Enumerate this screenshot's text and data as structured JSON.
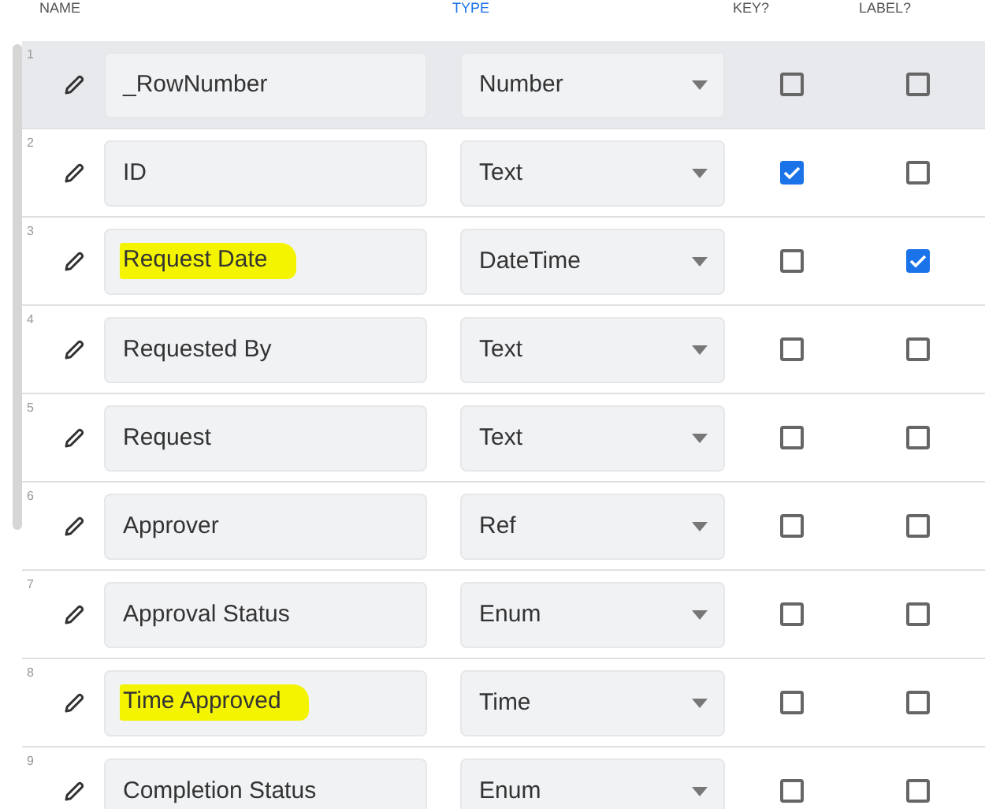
{
  "columns": [
    {
      "label": "NAME",
      "active": false
    },
    {
      "label": "TYPE",
      "active": true
    },
    {
      "label": "KEY?",
      "active": false
    },
    {
      "label": "LABEL?",
      "active": false
    }
  ],
  "rows": [
    {
      "number": "1",
      "name": "_RowNumber",
      "type": "Number",
      "key": false,
      "label": false,
      "selected": true,
      "highlighted": false
    },
    {
      "number": "2",
      "name": "ID",
      "type": "Text",
      "key": true,
      "label": false,
      "selected": false,
      "highlighted": false
    },
    {
      "number": "3",
      "name": "Request Date",
      "type": "DateTime",
      "key": false,
      "label": true,
      "selected": false,
      "highlighted": true
    },
    {
      "number": "4",
      "name": "Requested By",
      "type": "Text",
      "key": false,
      "label": false,
      "selected": false,
      "highlighted": false
    },
    {
      "number": "5",
      "name": "Request",
      "type": "Text",
      "key": false,
      "label": false,
      "selected": false,
      "highlighted": false
    },
    {
      "number": "6",
      "name": "Approver",
      "type": "Ref",
      "key": false,
      "label": false,
      "selected": false,
      "highlighted": false
    },
    {
      "number": "7",
      "name": "Approval Status",
      "type": "Enum",
      "key": false,
      "label": false,
      "selected": false,
      "highlighted": false
    },
    {
      "number": "8",
      "name": "Time Approved",
      "type": "Time",
      "key": false,
      "label": false,
      "selected": false,
      "highlighted": true
    },
    {
      "number": "9",
      "name": "Completion Status",
      "type": "Enum",
      "key": false,
      "label": false,
      "selected": false,
      "highlighted": false
    }
  ]
}
